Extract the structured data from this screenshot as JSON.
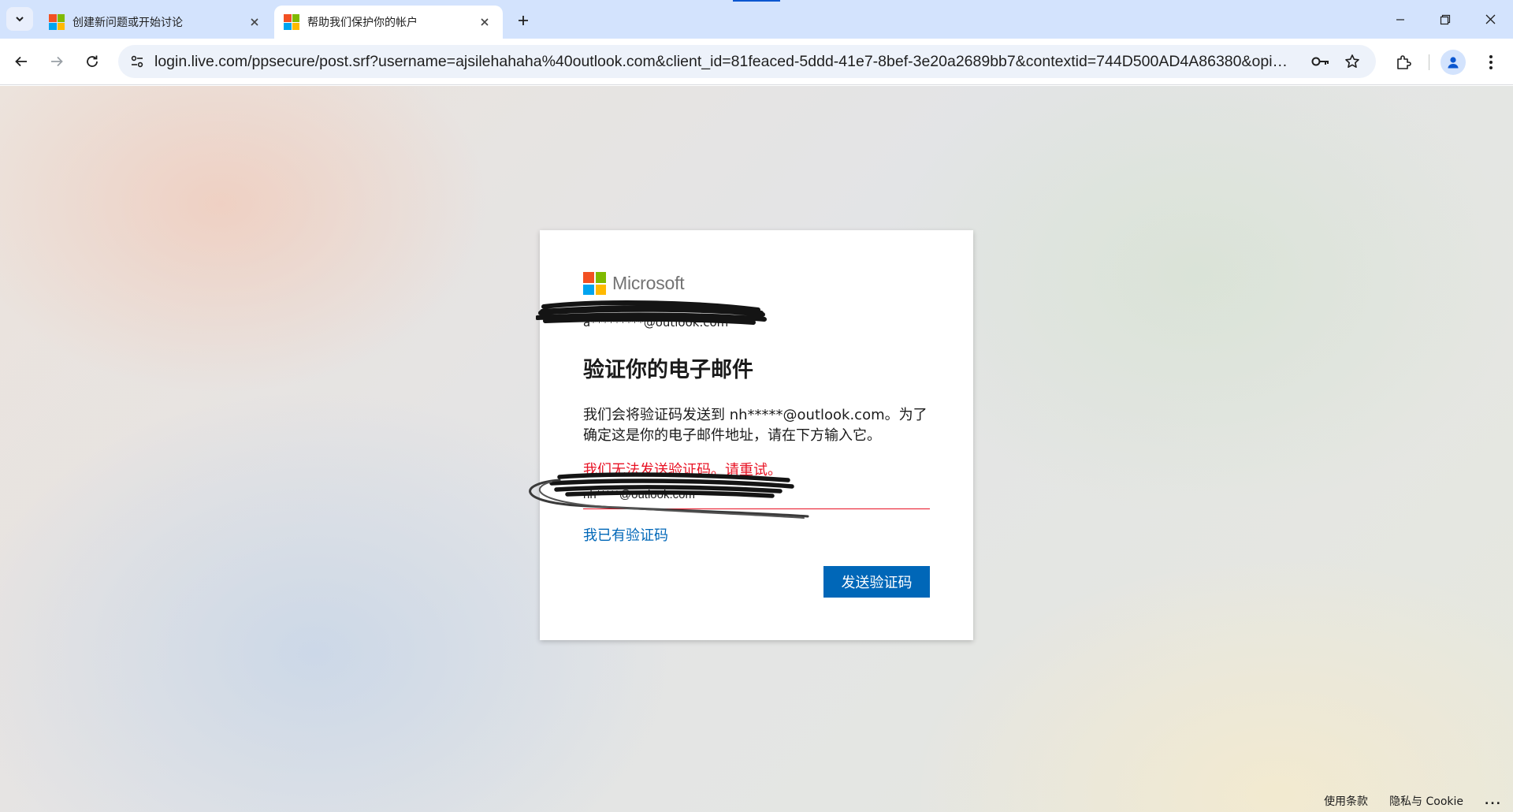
{
  "browser": {
    "tabs": [
      {
        "title": "创建新问题或开始讨论",
        "active": false
      },
      {
        "title": "帮助我们保护你的帐户",
        "active": true
      }
    ],
    "url": "login.live.com/ppsecure/post.srf?username=ajsilehahaha%40outlook.com&client_id=81feaced-5ddd-41e7-8bef-3e20a2689bb7&contextid=744D500AD4A86380&opid=28..."
  },
  "card": {
    "brand": "Microsoft",
    "identity": "a*********@outlook.com",
    "title": "验证你的电子邮件",
    "description": "我们会将验证码发送到 nh*****@outlook.com。为了确定这是你的电子邮件地址，请在下方输入它。",
    "error": "我们无法发送验证码。请重试。",
    "email_value": "nh*****@outlook.com",
    "have_code_link": "我已有验证码",
    "send_button": "发送验证码"
  },
  "footer": {
    "terms": "使用条款",
    "privacy": "隐私与 Cookie",
    "more": "..."
  },
  "colors": {
    "ms_red": "#f25022",
    "ms_green": "#7fba00",
    "ms_blue": "#00a4ef",
    "ms_yellow": "#ffb900",
    "accent": "#0067b8",
    "error": "#e81123"
  }
}
